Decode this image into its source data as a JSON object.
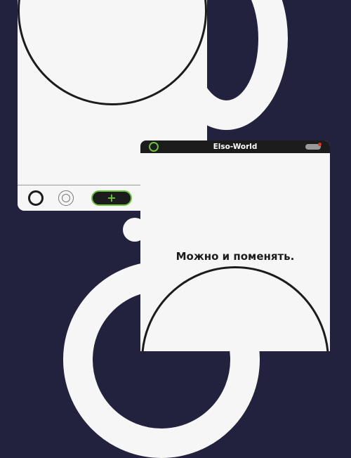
{
  "right_window": {
    "title": "Elso-World",
    "message": "Можно и поменять."
  },
  "left_window": {
    "toolbar": {
      "add_label": "+"
    }
  },
  "colors": {
    "background": "#22223f",
    "panel": "#f6f6f6",
    "dark": "#1c1c1c",
    "accent_green": "#6cc33c",
    "alert_red": "#e0321e"
  },
  "icons": [
    "ring-icon",
    "target-icon",
    "plus-icon",
    "status-ring-icon",
    "toggle-icon",
    "notification-dot-icon"
  ]
}
